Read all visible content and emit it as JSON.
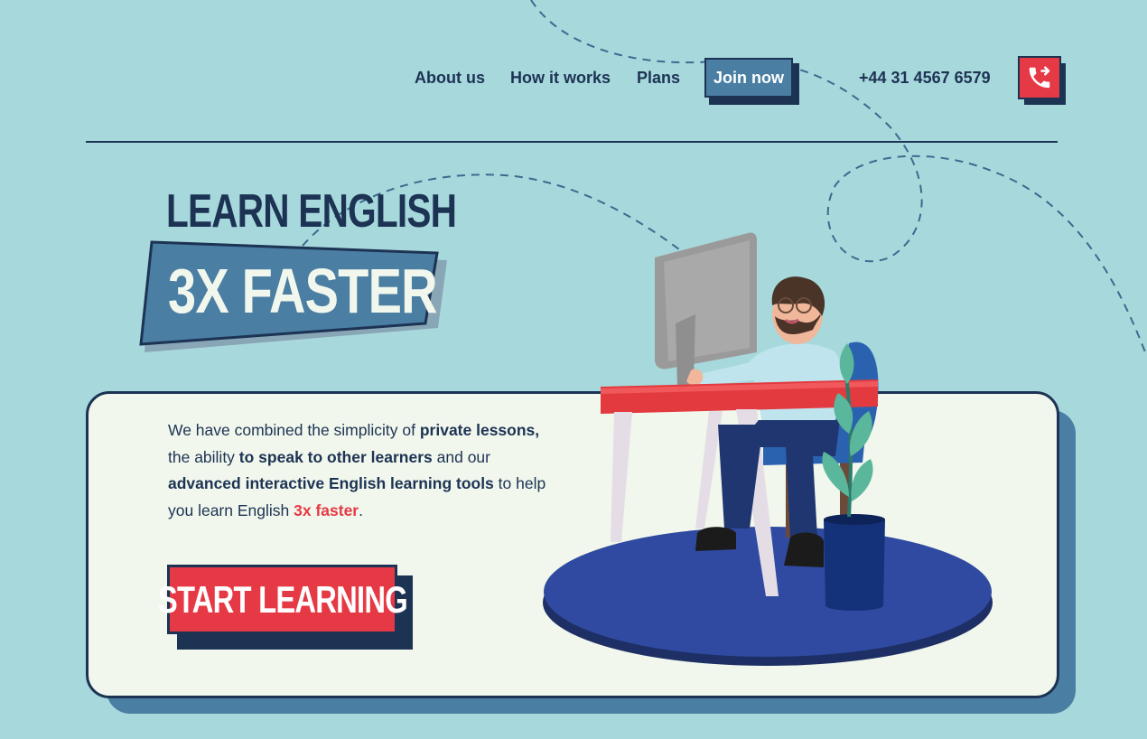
{
  "nav": {
    "links": [
      {
        "label": "About us"
      },
      {
        "label": "How it works"
      },
      {
        "label": "Plans"
      }
    ],
    "join_label": "Join now",
    "phone": "+44 31 4567 6579",
    "phone_icon": "phone-forward-icon"
  },
  "hero": {
    "title_line1": "LEARN ENGLISH",
    "title_line2": "3X FASTER"
  },
  "card": {
    "description": {
      "t1": "We have combined the simplicity of ",
      "b1": "private lessons,",
      "t2": " the ability ",
      "b2": "to speak to other learners",
      "t3": " and our ",
      "b3": "advanced interactive English learning tools",
      "t4": " to help you learn English ",
      "highlight": "3x faster",
      "t5": "."
    },
    "cta_label": "START LEARNING",
    "illustration": "person-at-computer-desk-illustration"
  },
  "colors": {
    "background": "#a7d9dc",
    "navy": "#1d3354",
    "steel_blue": "#4a7ea3",
    "accent_red": "#e63946",
    "card_bg": "#f1f7ec"
  }
}
